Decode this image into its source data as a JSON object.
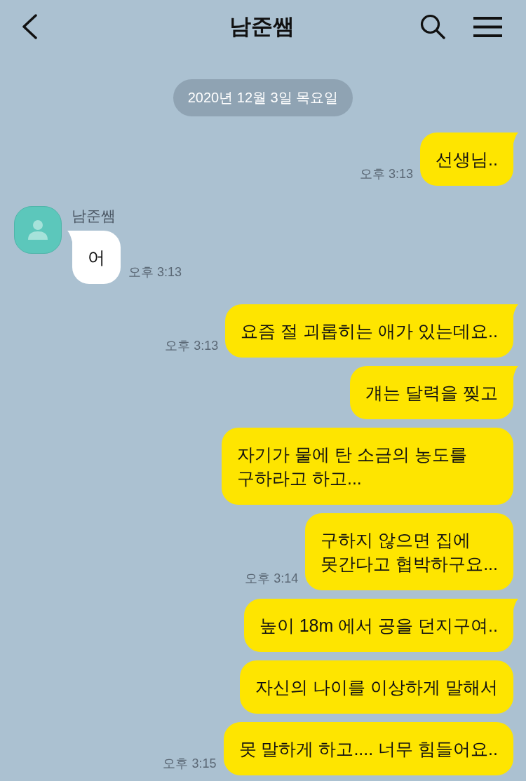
{
  "header": {
    "title": "남준쌤"
  },
  "date_divider": "2020년 12월 3일 목요일",
  "messages": [
    {
      "kind": "sent",
      "text": "선생님..",
      "time": "오후 3:13",
      "tail": true
    },
    {
      "kind": "received",
      "sender": "남준쌤",
      "text": "어",
      "time": "오후 3:13",
      "tail": true
    },
    {
      "kind": "sent",
      "text": "요즘 절 괴롭히는 애가 있는데요..",
      "time": "오후 3:13",
      "tail": true
    },
    {
      "kind": "sent",
      "text": "걔는 달력을 찢고",
      "tail": true
    },
    {
      "kind": "sent",
      "text": "자기가 물에 탄 소금의 농도를 구하라고 하고...",
      "tail": false
    },
    {
      "kind": "sent",
      "text": "구하지 않으면 집에\n못간다고 협박하구요...",
      "time": "오후 3:14",
      "tail": false
    },
    {
      "kind": "sent",
      "text": "높이 18m 에서 공을 던지구여..",
      "tail": true
    },
    {
      "kind": "sent",
      "text": "자신의 나이를 이상하게 말해서",
      "tail": false
    },
    {
      "kind": "sent",
      "text": "못 말하게 하고.... 너무 힘들어요..",
      "time": "오후 3:15",
      "tail": false
    }
  ]
}
